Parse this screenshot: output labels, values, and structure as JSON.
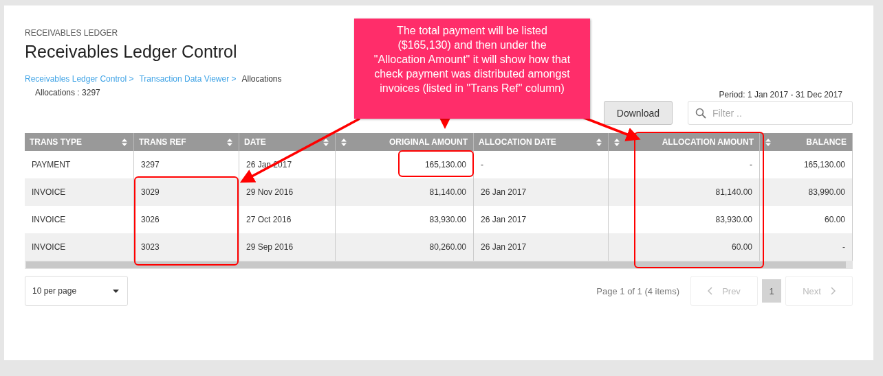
{
  "header": {
    "eyebrow": "RECEIVABLES LEDGER",
    "title": "Receivables Ledger Control"
  },
  "breadcrumbs": [
    {
      "label": "Receivables Ledger Control >",
      "link": true
    },
    {
      "label": "Transaction Data Viewer >",
      "link": true
    },
    {
      "label": "Allocations",
      "link": false
    }
  ],
  "subtitle": "Allocations : 3297",
  "period": "Period: 1 Jan 2017 - 31 Dec 2017",
  "download_button": "Download",
  "filter": {
    "placeholder": "Filter .."
  },
  "table": {
    "columns": [
      {
        "label": "TRANS TYPE",
        "numeric": false
      },
      {
        "label": "TRANS REF",
        "numeric": false
      },
      {
        "label": "DATE",
        "numeric": false
      },
      {
        "label": "ORIGINAL AMOUNT",
        "numeric": true
      },
      {
        "label": "ALLOCATION DATE",
        "numeric": false
      },
      {
        "label": "ALLOCATION AMOUNT",
        "numeric": true
      },
      {
        "label": "BALANCE",
        "numeric": true
      }
    ],
    "rows": [
      [
        "PAYMENT",
        "3297",
        "26 Jan 2017",
        "165,130.00",
        "-",
        "-",
        "165,130.00"
      ],
      [
        "INVOICE",
        "3029",
        "29 Nov 2016",
        "81,140.00",
        "26 Jan 2017",
        "81,140.00",
        "83,990.00"
      ],
      [
        "INVOICE",
        "3026",
        "27 Oct 2016",
        "83,930.00",
        "26 Jan 2017",
        "83,930.00",
        "60.00"
      ],
      [
        "INVOICE",
        "3023",
        "29 Sep 2016",
        "80,260.00",
        "26 Jan 2017",
        "60.00",
        "-"
      ]
    ]
  },
  "pagination": {
    "per_page": "10 per page",
    "summary": "Page 1 of 1 (4 items)",
    "prev": "Prev",
    "pages": [
      {
        "label": "1",
        "selected": true
      }
    ],
    "next": "Next"
  },
  "annotation": {
    "text": "The total payment will be listed ($165,130) and then under the \"Allocation Amount\" it will show how that check payment was distributed amongst invoices (listed in \"Trans Ref\" column)"
  }
}
